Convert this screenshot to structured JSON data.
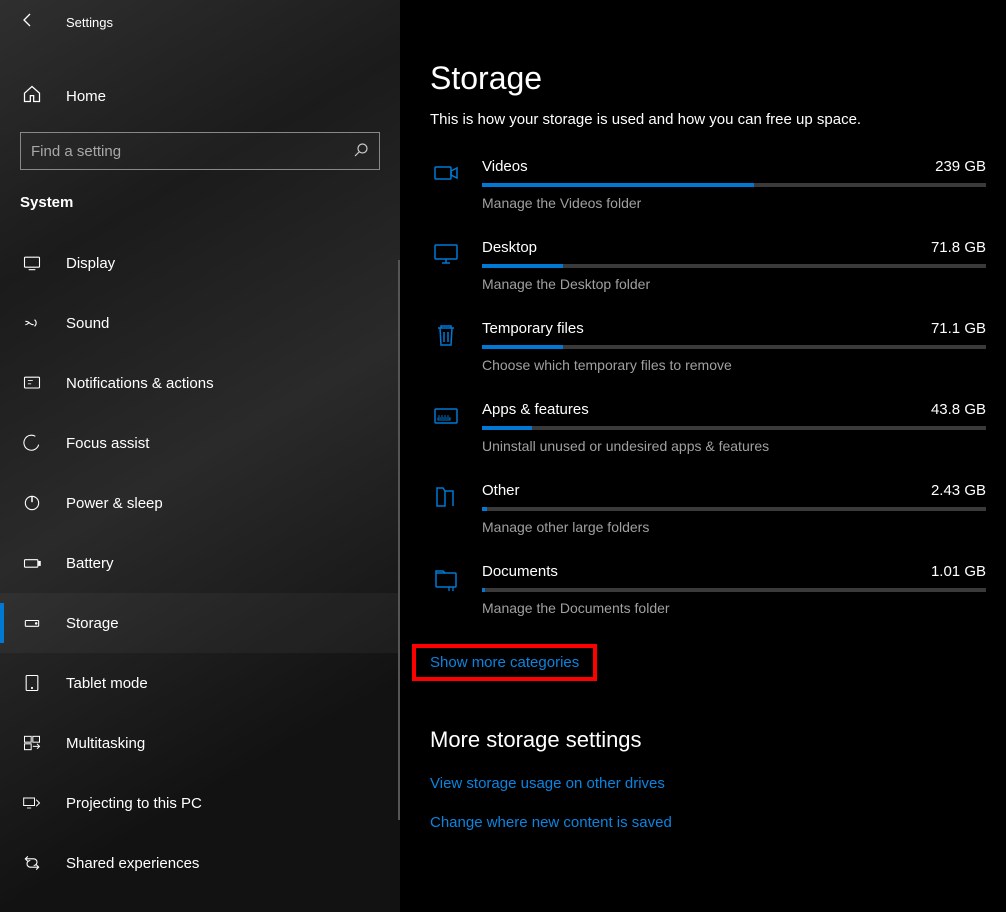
{
  "header": {
    "app_title": "Settings"
  },
  "home": {
    "label": "Home"
  },
  "search": {
    "placeholder": "Find a setting"
  },
  "section": {
    "label": "System"
  },
  "nav": {
    "items": [
      {
        "label": "Display"
      },
      {
        "label": "Sound"
      },
      {
        "label": "Notifications & actions"
      },
      {
        "label": "Focus assist"
      },
      {
        "label": "Power & sleep"
      },
      {
        "label": "Battery"
      },
      {
        "label": "Storage"
      },
      {
        "label": "Tablet mode"
      },
      {
        "label": "Multitasking"
      },
      {
        "label": "Projecting to this PC"
      },
      {
        "label": "Shared experiences"
      }
    ],
    "active_index": 6
  },
  "page": {
    "title": "Storage",
    "subtitle": "This is how your storage is used and how you can free up space."
  },
  "storage": {
    "items": [
      {
        "name": "Videos",
        "size": "239 GB",
        "pct": 54,
        "desc": "Manage the Videos folder",
        "icon": "video"
      },
      {
        "name": "Desktop",
        "size": "71.8 GB",
        "pct": 16,
        "desc": "Manage the Desktop folder",
        "icon": "desktop"
      },
      {
        "name": "Temporary files",
        "size": "71.1 GB",
        "pct": 16,
        "desc": "Choose which temporary files to remove",
        "icon": "trash"
      },
      {
        "name": "Apps & features",
        "size": "43.8 GB",
        "pct": 10,
        "desc": "Uninstall unused or undesired apps & features",
        "icon": "apps"
      },
      {
        "name": "Other",
        "size": "2.43 GB",
        "pct": 1,
        "desc": "Manage other large folders",
        "icon": "folder"
      },
      {
        "name": "Documents",
        "size": "1.01 GB",
        "pct": 0.5,
        "desc": "Manage the Documents folder",
        "icon": "document"
      }
    ]
  },
  "links": {
    "show_more": "Show more categories",
    "section_title": "More storage settings",
    "view_other": "View storage usage on other drives",
    "change_saved": "Change where new content is saved"
  },
  "colors": {
    "accent": "#0078d4",
    "link": "#0b84e0"
  }
}
